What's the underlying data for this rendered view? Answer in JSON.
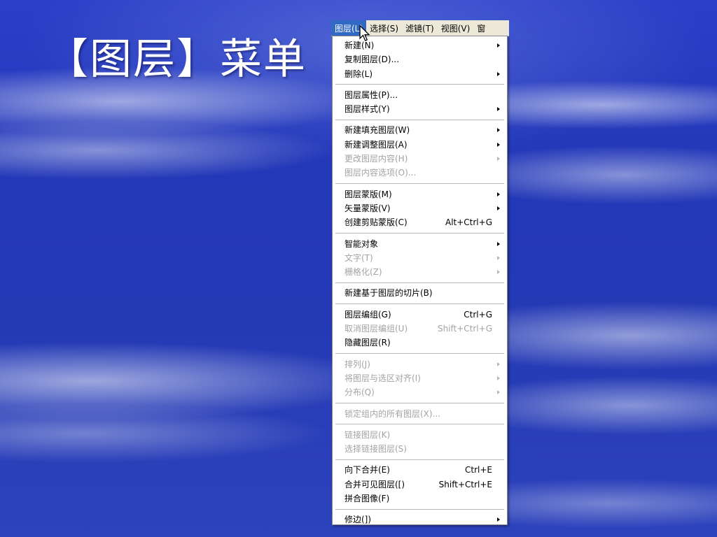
{
  "slide": {
    "title": "【图层】菜单"
  },
  "menubar": {
    "items": [
      {
        "label": "图层(L)",
        "active": true
      },
      {
        "label": "选择(S)"
      },
      {
        "label": "滤镜(T)"
      },
      {
        "label": "视图(V)"
      },
      {
        "label": "窗"
      }
    ]
  },
  "menu": {
    "groups": [
      [
        {
          "label": "新建(N)",
          "submenu": true
        },
        {
          "label": "复制图层(D)..."
        },
        {
          "label": "删除(L)",
          "submenu": true
        }
      ],
      [
        {
          "label": "图层属性(P)..."
        },
        {
          "label": "图层样式(Y)",
          "submenu": true
        }
      ],
      [
        {
          "label": "新建填充图层(W)",
          "submenu": true
        },
        {
          "label": "新建调整图层(A)",
          "submenu": true
        },
        {
          "label": "更改图层内容(H)",
          "submenu": true,
          "disabled": true
        },
        {
          "label": "图层内容选项(O)...",
          "disabled": true
        }
      ],
      [
        {
          "label": "图层蒙版(M)",
          "submenu": true
        },
        {
          "label": "矢量蒙版(V)",
          "submenu": true
        },
        {
          "label": "创建剪贴蒙版(C)",
          "shortcut": "Alt+Ctrl+G"
        }
      ],
      [
        {
          "label": "智能对象",
          "submenu": true
        },
        {
          "label": "文字(T)",
          "submenu": true,
          "disabled": true
        },
        {
          "label": "栅格化(Z)",
          "submenu": true,
          "disabled": true
        }
      ],
      [
        {
          "label": "新建基于图层的切片(B)"
        }
      ],
      [
        {
          "label": "图层编组(G)",
          "shortcut": "Ctrl+G"
        },
        {
          "label": "取消图层编组(U)",
          "shortcut": "Shift+Ctrl+G",
          "disabled": true
        },
        {
          "label": "隐藏图层(R)"
        }
      ],
      [
        {
          "label": "排列(J)",
          "submenu": true,
          "disabled": true
        },
        {
          "label": "将图层与选区对齐(I)",
          "submenu": true,
          "disabled": true
        },
        {
          "label": "分布(Q)",
          "submenu": true,
          "disabled": true
        }
      ],
      [
        {
          "label": "锁定组内的所有图层(X)...",
          "disabled": true
        }
      ],
      [
        {
          "label": "链接图层(K)",
          "disabled": true
        },
        {
          "label": "选择链接图层(S)",
          "disabled": true
        }
      ],
      [
        {
          "label": "向下合并(E)",
          "shortcut": "Ctrl+E"
        },
        {
          "label": "合并可见图层([)",
          "shortcut": "Shift+Ctrl+E"
        },
        {
          "label": "拼合图像(F)"
        }
      ],
      [
        {
          "label": "修边(])",
          "submenu": true
        }
      ]
    ]
  }
}
